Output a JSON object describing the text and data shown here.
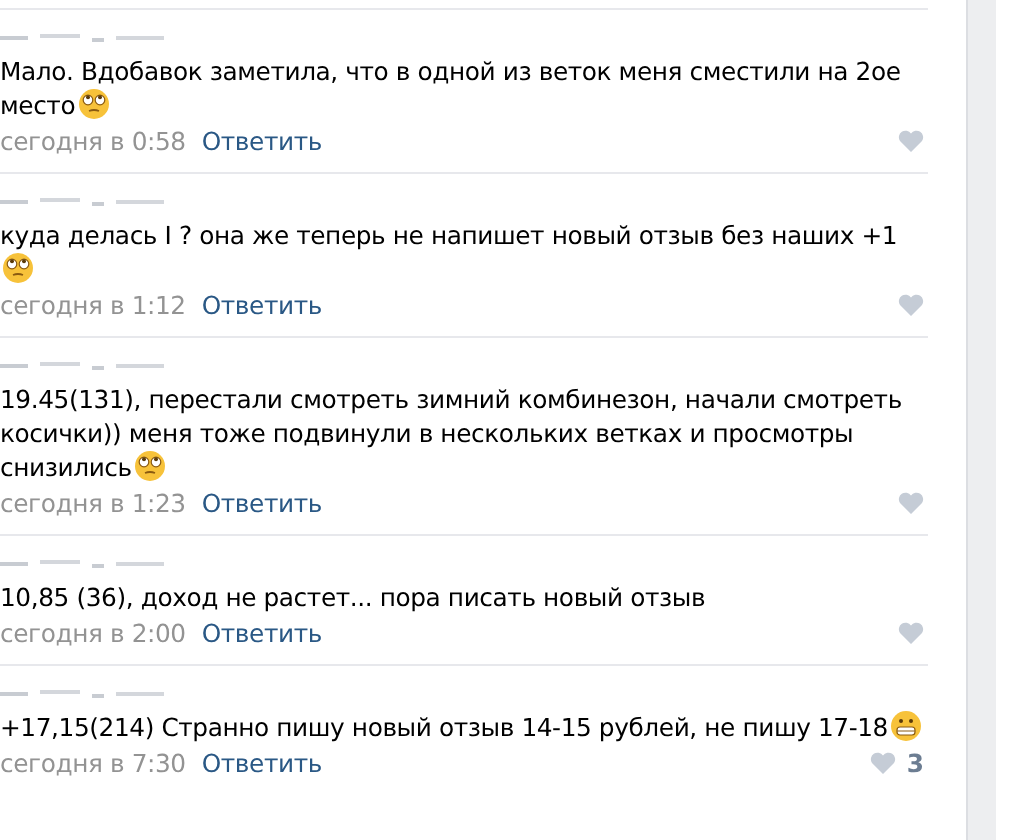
{
  "comments": [
    {
      "text": "Мало. Вдобавок заметила, что в одной из веток меня сместили на 2ое место",
      "emoji": {
        "kind": "eyeroll"
      },
      "time": "сегодня в 0:58",
      "reply": "Ответить"
    },
    {
      "text": "куда делась I       ? она же теперь не напишет новый отзыв без наших +1",
      "emoji": {
        "kind": "eyeroll"
      },
      "time": "сегодня в 1:12",
      "reply": "Ответить"
    },
    {
      "text": "19.45(131), перестали смотреть зимний комбинезон, начали смотреть косички)) меня тоже подвинули в нескольких ветках и просмотры снизились",
      "emoji": {
        "kind": "eyeroll"
      },
      "time": "сегодня в 1:23",
      "reply": "Ответить"
    },
    {
      "text": "10,85 (36), доход не растет... пора писать новый отзыв",
      "time": "сегодня в 2:00",
      "reply": "Ответить"
    },
    {
      "text": "+17,15(214) Странно пишу новый отзыв 14-15 рублей, не пишу 17-18",
      "emoji": {
        "kind": "grimace"
      },
      "time": "сегодня в 7:30",
      "reply": "Ответить",
      "likes": "3"
    }
  ]
}
